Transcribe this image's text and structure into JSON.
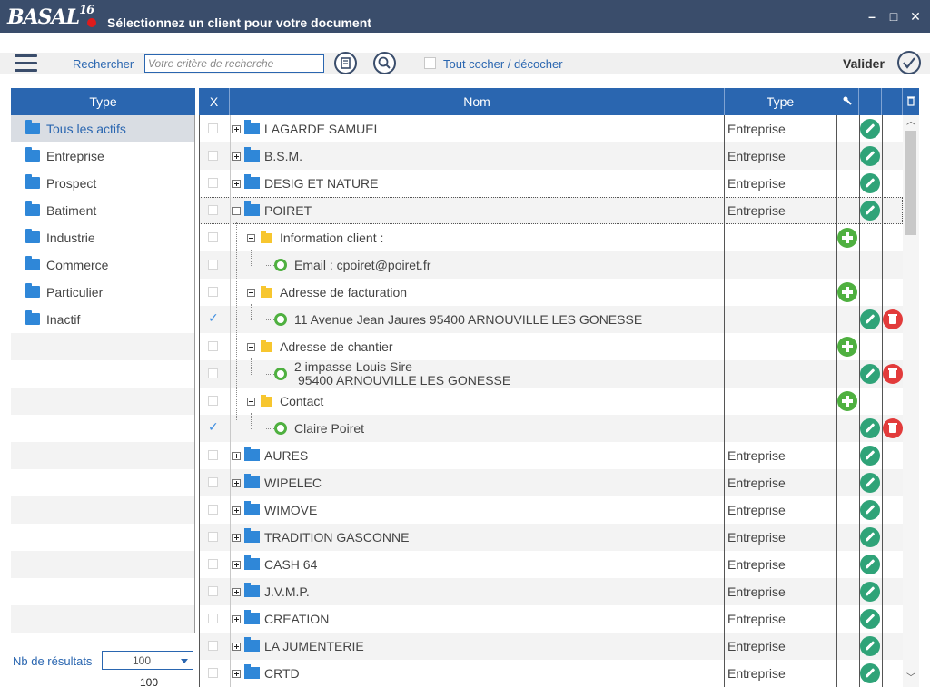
{
  "window": {
    "logo": "BASAL",
    "logo_version": "16",
    "title": "Sélectionnez un client pour votre document",
    "buttons": {
      "minimize": "–",
      "maximize": "□",
      "close": "✕"
    }
  },
  "toolbar": {
    "search_label": "Rechercher",
    "search_placeholder": "Votre critère de recherche",
    "search_value": "",
    "check_all_label": "Tout cocher / décocher",
    "validate_label": "Valider"
  },
  "type_panel": {
    "header": "Type",
    "items": [
      {
        "label": "Tous les actifs",
        "selected": true
      },
      {
        "label": "Entreprise",
        "selected": false
      },
      {
        "label": "Prospect",
        "selected": false
      },
      {
        "label": "Batiment",
        "selected": false
      },
      {
        "label": "Industrie",
        "selected": false
      },
      {
        "label": "Commerce",
        "selected": false
      },
      {
        "label": "Particulier",
        "selected": false
      },
      {
        "label": "Inactif",
        "selected": false
      }
    ]
  },
  "results": {
    "label": "Nb de résultats",
    "selected": "100",
    "total": "100"
  },
  "grid": {
    "columns": {
      "check": "X",
      "name": "Nom",
      "type": "Type"
    },
    "rows": [
      {
        "level": 0,
        "name": "LAGARDE SAMUEL",
        "type": "Entreprise",
        "checked": false,
        "expanded": false
      },
      {
        "level": 0,
        "name": "B.S.M.",
        "type": "Entreprise",
        "checked": false,
        "expanded": false
      },
      {
        "level": 0,
        "name": "DESIG ET NATURE",
        "type": "Entreprise",
        "checked": false,
        "expanded": false
      },
      {
        "level": 0,
        "name": "POIRET",
        "type": "Entreprise",
        "checked": false,
        "expanded": true
      },
      {
        "level": 1,
        "name": "Information client  :",
        "type": "",
        "checked": false
      },
      {
        "level": 2,
        "name": "Email : cpoiret@poiret.fr",
        "type": "",
        "checked": false
      },
      {
        "level": 1,
        "name": "Adresse de facturation",
        "type": "",
        "checked": false
      },
      {
        "level": 2,
        "name": "11 Avenue Jean Jaures 95400 ARNOUVILLE LES GONESSE",
        "type": "",
        "checked": true
      },
      {
        "level": 1,
        "name": "Adresse de chantier",
        "type": "",
        "checked": false
      },
      {
        "level": 2,
        "name": "2 impasse Louis Sire",
        "name2": "95400 ARNOUVILLE LES GONESSE",
        "type": "",
        "checked": false
      },
      {
        "level": 1,
        "name": "Contact",
        "type": "",
        "checked": false
      },
      {
        "level": 2,
        "name": "Claire Poiret",
        "type": "",
        "checked": true
      },
      {
        "level": 0,
        "name": "AURES",
        "type": "Entreprise",
        "checked": false,
        "expanded": false
      },
      {
        "level": 0,
        "name": "WIPELEC",
        "type": "Entreprise",
        "checked": false,
        "expanded": false
      },
      {
        "level": 0,
        "name": "WIMOVE",
        "type": "Entreprise",
        "checked": false,
        "expanded": false
      },
      {
        "level": 0,
        "name": "TRADITION GASCONNE",
        "type": "Entreprise",
        "checked": false,
        "expanded": false
      },
      {
        "level": 0,
        "name": "CASH 64",
        "type": "Entreprise",
        "checked": false,
        "expanded": false
      },
      {
        "level": 0,
        "name": "J.V.M.P.",
        "type": "Entreprise",
        "checked": false,
        "expanded": false
      },
      {
        "level": 0,
        "name": "CREATION",
        "type": "Entreprise",
        "checked": false,
        "expanded": false
      },
      {
        "level": 0,
        "name": "LA JUMENTERIE",
        "type": "Entreprise",
        "checked": false,
        "expanded": false
      },
      {
        "level": 0,
        "name": "CRTD",
        "type": "Entreprise",
        "checked": false,
        "expanded": false
      }
    ]
  },
  "colors": {
    "header_blue": "#2a66b0",
    "titlebar": "#3a4d6b",
    "edit_green": "#2fa378",
    "add_green": "#4fb040",
    "delete_red": "#e23b3b",
    "folder_blue": "#2f87d8",
    "folder_yellow": "#f7c62f"
  }
}
